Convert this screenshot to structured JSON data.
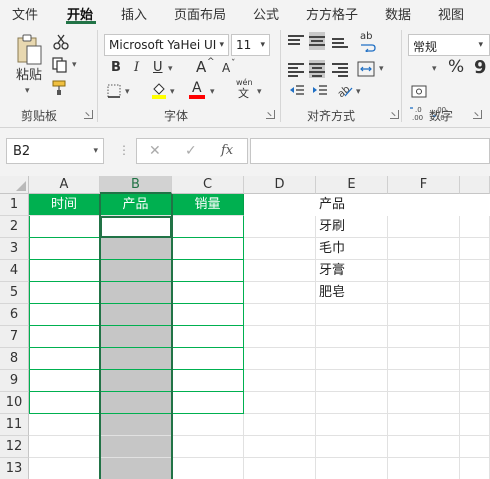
{
  "menu": {
    "items": [
      "文件",
      "开始",
      "插入",
      "页面布局",
      "公式",
      "方方格子",
      "数据",
      "视图"
    ],
    "active_index": 1
  },
  "ribbon": {
    "clipboard": {
      "paste_label": "粘贴",
      "group_label": "剪贴板"
    },
    "font": {
      "font_name": "Microsoft YaHei UI",
      "font_size": "11",
      "bold": "B",
      "italic": "I",
      "underline": "U",
      "grow": "A",
      "shrink": "A",
      "font_color_letter": "A",
      "phonetic": "wén",
      "group_label": "字体",
      "highlight_color": "#ffff00",
      "font_color": "#ff0000"
    },
    "alignment": {
      "group_label": "对齐方式",
      "wrap_label": "ab"
    },
    "number": {
      "format": "常规",
      "percent": "%",
      "comma": "9",
      "group_label": "数字"
    }
  },
  "formula_bar": {
    "name_box": "B2",
    "cancel": "✕",
    "enter": "✓",
    "fx": "fx",
    "value": ""
  },
  "sheet": {
    "columns": [
      "A",
      "B",
      "C",
      "D",
      "E",
      "F"
    ],
    "rows": [
      "1",
      "2",
      "3",
      "4",
      "5",
      "6",
      "7",
      "8",
      "9",
      "10",
      "11",
      "12",
      "13"
    ],
    "selected_column": "B",
    "active_cell": "B2",
    "table_headers": [
      "时间",
      "产品",
      "销量"
    ],
    "list": [
      "产品",
      "牙刷",
      "毛巾",
      "牙膏",
      "肥皂"
    ],
    "header_fill": "#00b050",
    "border_color": "#00b050",
    "selection_fill": "#c6c6c6"
  }
}
